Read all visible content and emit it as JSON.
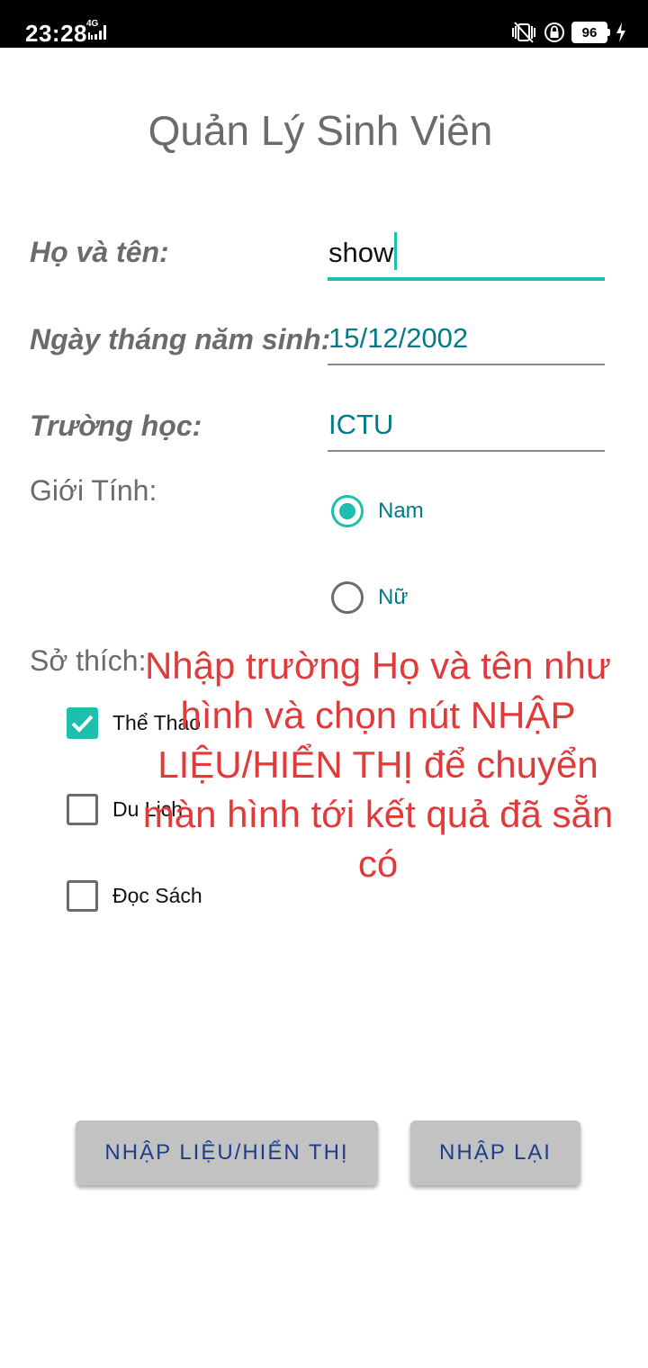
{
  "status_bar": {
    "time": "23:28",
    "network": "4G",
    "battery": "96"
  },
  "app": {
    "title": "Quản Lý Sinh Viên"
  },
  "form": {
    "name": {
      "label": "Họ và tên:",
      "value": "show"
    },
    "dob": {
      "label": "Ngày tháng năm sinh:",
      "value": "15/12/2002"
    },
    "school": {
      "label": "Trường học:",
      "value": "ICTU"
    },
    "gender": {
      "label": "Giới Tính:",
      "options": [
        {
          "label": "Nam",
          "selected": true
        },
        {
          "label": "Nữ",
          "selected": false
        }
      ]
    },
    "hobbies": {
      "label": "Sở thích:",
      "items": [
        {
          "label": "Thể Thao",
          "checked": true
        },
        {
          "label": "Du Lịch",
          "checked": false
        },
        {
          "label": "Đọc Sách",
          "checked": false
        }
      ]
    }
  },
  "overlay_note": "Nhập trường Họ và tên như hình và chọn nút NHẬP LIỆU/HIỂN THỊ để chuyển màn hình tới kết quả đã sẵn có",
  "buttons": {
    "submit": "NHẬP LIỆU/HIỂN THỊ",
    "reset": "NHẬP LẠI"
  },
  "colors": {
    "accent": "#1fbfae",
    "value_text": "#007b8a",
    "label_text": "#6b6b6b",
    "button_bg": "#c2c2c2",
    "button_text": "#1a3e8c",
    "overlay_text": "#e03a3a"
  }
}
